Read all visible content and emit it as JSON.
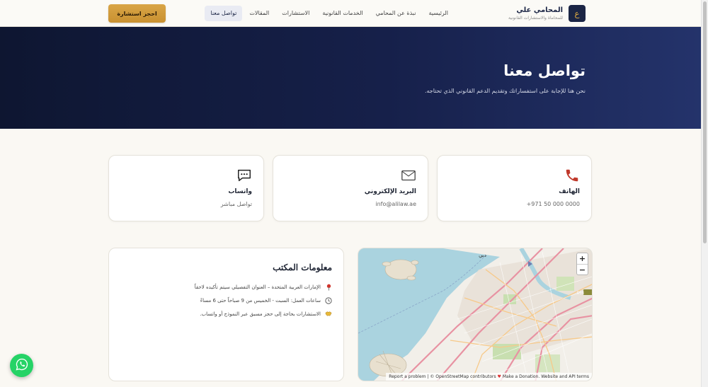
{
  "header": {
    "brand_logo": "ع",
    "brand_name": "المحامي علي",
    "brand_tagline": "للمحاماة والاستشارات القانونية",
    "nav": [
      {
        "label": "الرئيسية",
        "active": false
      },
      {
        "label": "نبذة عن المحامي",
        "active": false
      },
      {
        "label": "الخدمات القانونية",
        "active": false
      },
      {
        "label": "الاستشارات",
        "active": false
      },
      {
        "label": "المقالات",
        "active": false
      },
      {
        "label": "تواصل معنا",
        "active": true
      }
    ],
    "cta_label": "احجز استشارة"
  },
  "hero": {
    "title": "تواصل معنا",
    "subtitle": "نحن هنا للإجابة على استفساراتك وتقديم الدعم القانوني الذي تحتاجه."
  },
  "cards": {
    "phone": {
      "title": "الهاتف",
      "value": "+971 50 000 0000",
      "icon": "phone-icon"
    },
    "email": {
      "title": "البريد الإلكتروني",
      "value": "info@alilaw.ae",
      "icon": "envelope-icon"
    },
    "whatsapp": {
      "title": "واتساب",
      "value": "تواصل مباشر",
      "icon": "chat-bubble-icon"
    }
  },
  "office": {
    "title": "معلومات المكتب",
    "items": [
      {
        "icon": "pin-icon",
        "text": "الإمارات العربية المتحدة – العنوان التفصيلي سيتم تأكيده لاحقاً"
      },
      {
        "icon": "clock-icon",
        "text": "ساعات العمل: السبت - الخميس من 9 صباحاً حتى 6 مساءً"
      },
      {
        "icon": "handshake-icon",
        "text": "الاستشارات بحاجة إلى حجز مسبق عبر النموذج أو واتساب."
      }
    ]
  },
  "map": {
    "zoom_in": "+",
    "zoom_out": "−",
    "label_city": "دبي",
    "label_road": "D54",
    "attribution_report": "Report a problem",
    "attribution_osm": "© OpenStreetMap contributors",
    "attribution_donate": "Make a Donation. Website and API terms"
  },
  "colors": {
    "navy": "#1b2545",
    "gold": "#d6a541",
    "whatsapp": "#25d366",
    "background": "#faf8f3"
  }
}
